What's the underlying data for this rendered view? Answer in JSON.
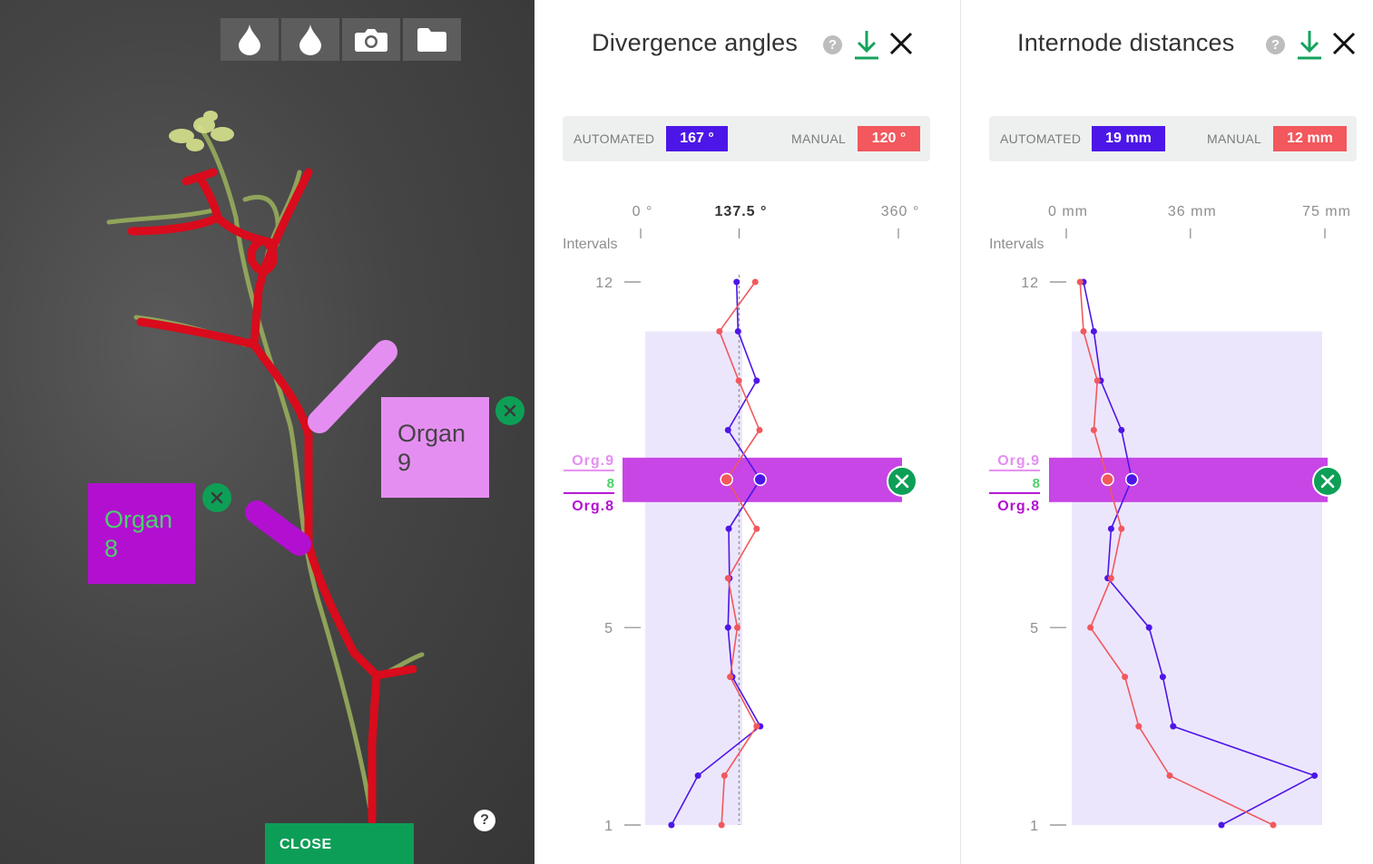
{
  "photo_panel": {
    "toolbar": [
      {
        "icon": "droplet-icon"
      },
      {
        "icon": "droplet-icon"
      },
      {
        "icon": "camera-icon"
      },
      {
        "icon": "folder-icon"
      }
    ],
    "organ_labels": [
      {
        "id": "organ-8",
        "text": "Organ\n8"
      },
      {
        "id": "organ-9",
        "text": "Organ\n9"
      }
    ],
    "close_label": "CLOSE",
    "help_label": "?"
  },
  "colors": {
    "automated": "#4d16e8",
    "manual": "#f2585d",
    "organ8": "#b30fd1",
    "organ9": "#e58ef2",
    "accent_green": "#0c9e57",
    "stem_red": "#d90b1c"
  },
  "divergence": {
    "title": "Divergence angles",
    "stats": {
      "automated_label": "AUTOMATED",
      "automated_value": "167 °",
      "manual_label": "MANUAL",
      "manual_value": "120 °"
    },
    "axis_ticks": [
      {
        "label": "0 °",
        "value": 0
      },
      {
        "label": "137.5 °",
        "value": 137.5
      },
      {
        "label": "360 °",
        "value": 360
      }
    ],
    "intervals_label": "Intervals",
    "selection": {
      "top": "Org.9",
      "mid": "8",
      "bottom": "Org.8"
    }
  },
  "internode": {
    "title": "Internode distances",
    "stats": {
      "automated_label": "AUTOMATED",
      "automated_value": "19 mm",
      "manual_label": "MANUAL",
      "manual_value": "12 mm"
    },
    "axis_ticks": [
      {
        "label": "0 mm",
        "value": 0
      },
      {
        "label": "36 mm",
        "value": 36
      },
      {
        "label": "75 mm",
        "value": 75
      }
    ],
    "intervals_label": "Intervals",
    "selection": {
      "top": "Org.9",
      "mid": "8",
      "bottom": "Org.8"
    }
  },
  "chart_data": [
    {
      "type": "line",
      "title": "Divergence angles",
      "xlabel": "",
      "ylabel": "Intervals",
      "xlim": [
        0,
        360
      ],
      "y_ticks": [
        "1",
        "5",
        "12"
      ],
      "reference_line": 137.5,
      "selected_interval": 8,
      "y": [
        1,
        2,
        3,
        4,
        5,
        6,
        7,
        8,
        9,
        10,
        11,
        12
      ],
      "series": [
        {
          "color": "#4d16e8",
          "values": [
            43,
            80,
            167,
            128,
            122,
            124,
            123,
            167,
            122,
            162,
            136,
            134
          ]
        },
        {
          "color": "#f2585d",
          "values": [
            113,
            117,
            162,
            125,
            135,
            122,
            162,
            120,
            166,
            137,
            110,
            160
          ]
        }
      ],
      "highlight_band": [
        1,
        11
      ]
    },
    {
      "type": "line",
      "title": "Internode distances",
      "xlabel": "",
      "ylabel": "Intervals",
      "xlim": [
        0,
        75
      ],
      "y_ticks": [
        "1",
        "5",
        "12"
      ],
      "selected_interval": 8,
      "y": [
        1,
        2,
        3,
        4,
        5,
        6,
        7,
        8,
        9,
        10,
        11,
        12
      ],
      "series": [
        {
          "color": "#4d16e8",
          "values": [
            45,
            72,
            31,
            28,
            24,
            12,
            13,
            19,
            16,
            10,
            8,
            5
          ]
        },
        {
          "color": "#f2585d",
          "values": [
            60,
            30,
            21,
            17,
            7,
            13,
            16,
            12,
            8,
            9,
            5,
            4
          ]
        }
      ],
      "highlight_band": [
        1,
        11
      ]
    }
  ]
}
